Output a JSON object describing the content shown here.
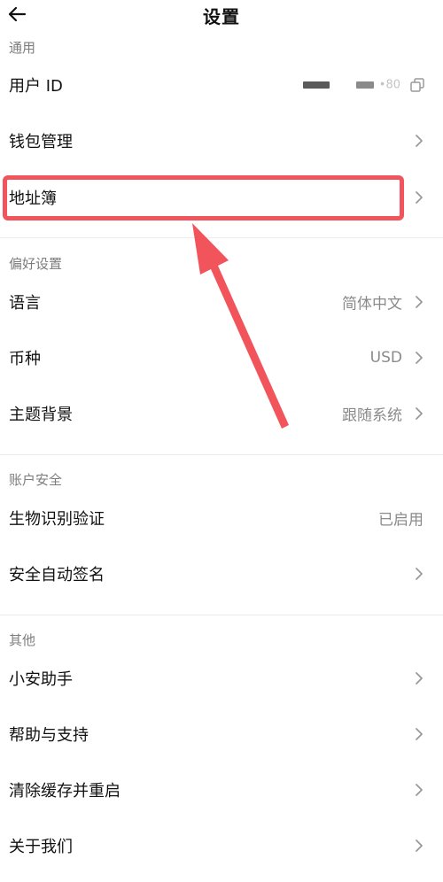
{
  "header": {
    "title": "设置"
  },
  "sections": {
    "general": {
      "label": "通用",
      "user_id": {
        "label": "用户 ID",
        "value_suffix": "•80"
      },
      "wallet": {
        "label": "钱包管理"
      },
      "address_book": {
        "label": "地址簿"
      }
    },
    "preferences": {
      "label": "偏好设置",
      "language": {
        "label": "语言",
        "value": "简体中文"
      },
      "currency": {
        "label": "币种",
        "value": "USD"
      },
      "theme": {
        "label": "主题背景",
        "value": "跟随系统"
      }
    },
    "security": {
      "label": "账户安全",
      "biometric": {
        "label": "生物识别验证",
        "value": "已启用"
      },
      "auto_sign": {
        "label": "安全自动签名"
      }
    },
    "other": {
      "label": "其他",
      "assistant": {
        "label": "小安助手"
      },
      "help": {
        "label": "帮助与支持"
      },
      "clear_cache": {
        "label": "清除缓存并重启"
      },
      "about": {
        "label": "关于我们"
      }
    }
  },
  "annotation": {
    "color": "#f2545b"
  },
  "icons": {
    "back": "arrow-left-icon",
    "chevron": "chevron-right-icon",
    "copy": "copy-icon"
  }
}
